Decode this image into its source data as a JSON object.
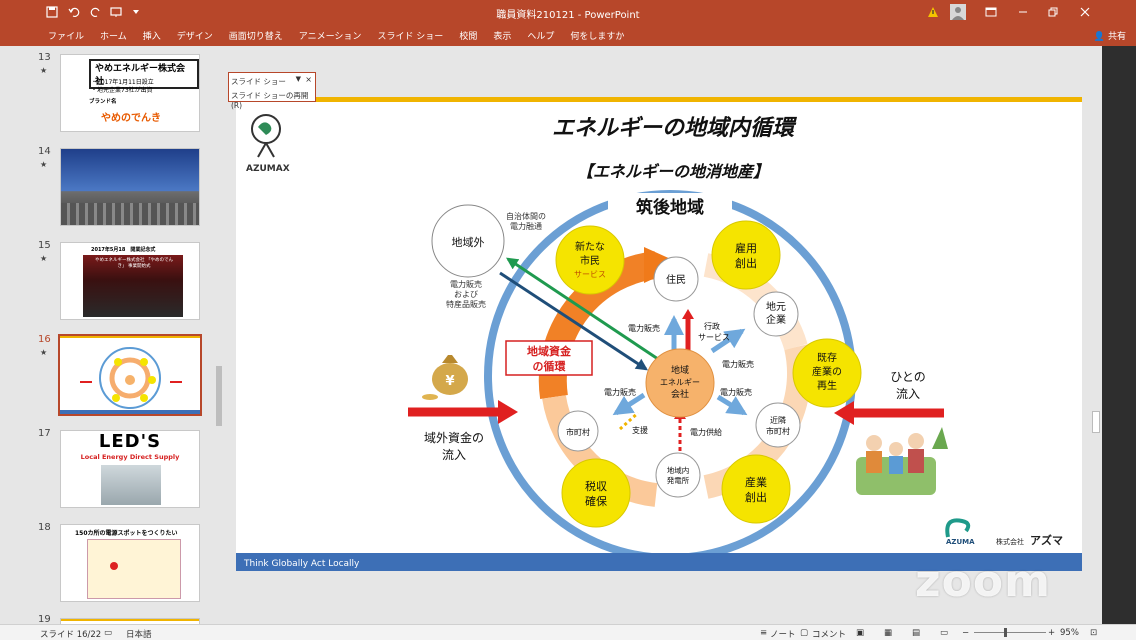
{
  "window": {
    "title": "職員資料210121 - PowerPoint",
    "share": "共有"
  },
  "ribbon_tabs": [
    "ファイル",
    "ホーム",
    "挿入",
    "デザイン",
    "画面切り替え",
    "アニメーション",
    "スライド ショー",
    "校閲",
    "表示",
    "ヘルプ",
    "何をしますか"
  ],
  "thumbnails": [
    {
      "num": "13",
      "star": "★",
      "title": "やめエネルギー株式会社",
      "line1": "・2017年1月11日設立",
      "line2": "・地元企業73社が出資",
      "brand_label": "ブランド名",
      "brand": "やめのでんき"
    },
    {
      "num": "14",
      "star": "★"
    },
    {
      "num": "15",
      "star": "★",
      "title": "2017年5月18　開業記念式",
      "sub": "やめエネルギー株式会社 「やめのでんき」 事業開始式"
    },
    {
      "num": "16",
      "star": "★"
    },
    {
      "num": "17",
      "title": "LED'S",
      "sub": "Local Energy Direct Supply"
    },
    {
      "num": "18",
      "title": "150カ所の電源スポットをつくりたい"
    },
    {
      "num": "19"
    }
  ],
  "slideshow_toolbar": {
    "title": "スライド ショー",
    "resume": "スライド ショーの再開(R)",
    "close": "×",
    "dropdown": "▼"
  },
  "slide": {
    "title": "エネルギーの地域内循環",
    "subtitle": "【エネルギーの地消地産】",
    "logo_text": "AZUMAX",
    "region": "筑後地域",
    "outside": "地域外",
    "outside_note1_l1": "自治体間の",
    "outside_note1_l2": "電力融通",
    "outside_note2_l1": "電力販売",
    "outside_note2_l2": "および",
    "outside_note2_l3": "特産品販売",
    "fund_cycle_l1": "地域資金",
    "fund_cycle_l2": "の循環",
    "outside_fund_l1": "域外資金の",
    "outside_fund_l2": "流入",
    "people_l1": "ひとの",
    "people_l2": "流入",
    "center_l1": "地域",
    "center_l2": "エネルギー",
    "center_l3": "会社",
    "nodes": {
      "residents": "住民",
      "local_corp_l1": "地元",
      "local_corp_l2": "企業",
      "neighbor_l1": "近隣",
      "neighbor_l2": "市町村",
      "local_gen_l1": "地域内",
      "local_gen_l2": "発電所",
      "municipality": "市町村"
    },
    "benefits": {
      "new_l1": "新たな",
      "new_l2": "市民",
      "new_l3": "サービス",
      "jobs_l1": "雇用",
      "jobs_l2": "創出",
      "rev_l1": "既存",
      "rev_l2": "産業の",
      "rev_l3": "再生",
      "ind_l1": "産業",
      "ind_l2": "創出",
      "tax_l1": "税収",
      "tax_l2": "確保"
    },
    "labels": {
      "sell1": "電力販売",
      "admin_l1": "行政",
      "admin_l2": "サービス",
      "sell2": "電力販売",
      "sell3": "電力販売",
      "sell4": "電力販売",
      "support": "支援",
      "supply": "電力供給"
    },
    "company_l1": "AZUMA",
    "company_l2": "株式会社",
    "company_l3": "アズマ",
    "footer": "Think Globally Act Locally"
  },
  "status": {
    "slide_pos": "スライド 16/22",
    "language": "日本語",
    "notes": "ノート",
    "comments": "コメント",
    "zoom": "95%"
  },
  "watermark": "zoom"
}
